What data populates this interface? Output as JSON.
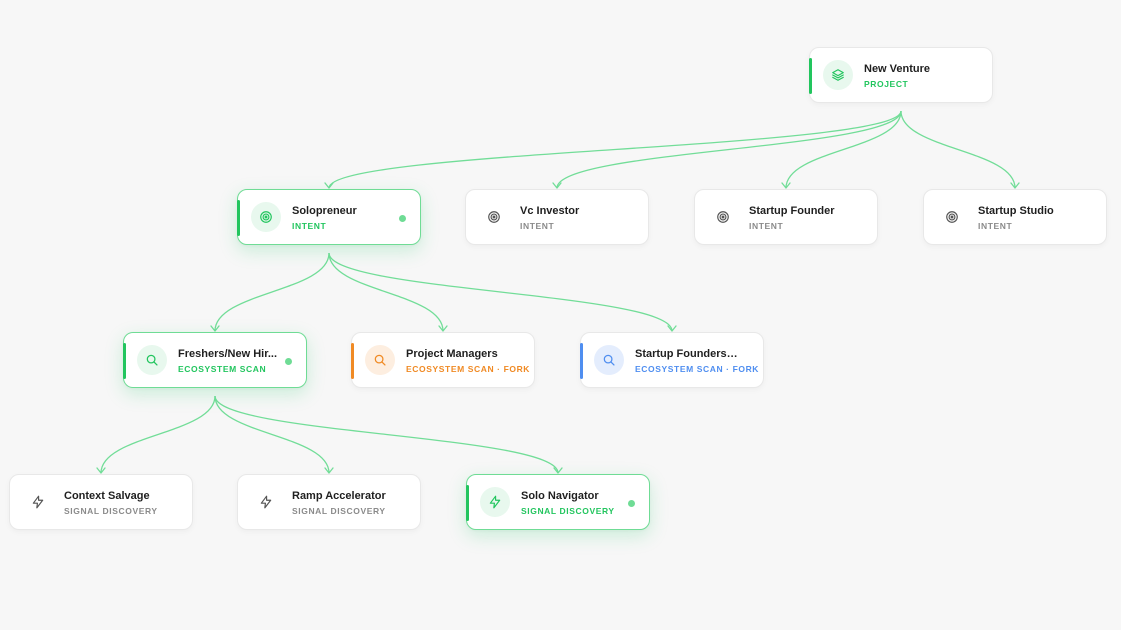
{
  "colors": {
    "green": "#22c55e",
    "green_soft": "#e8f8ee",
    "green_dot": "#6fdc95",
    "gray_text": "#8a8a8a",
    "orange": "#f08a24",
    "orange_soft": "#fdeee0",
    "blue": "#4f8ef0",
    "blue_soft": "#e4edfd",
    "edge": "#72dd98"
  },
  "nodes": [
    {
      "id": "new-venture",
      "title": "New Venture",
      "subtitle": "PROJECT",
      "icon": "layers-icon",
      "variant": "project",
      "active": false
    },
    {
      "id": "solopreneur",
      "title": "Solopreneur",
      "subtitle": "INTENT",
      "icon": "target-icon",
      "variant": "intent-active",
      "active": true
    },
    {
      "id": "vc-investor",
      "title": "Vc Investor",
      "subtitle": "INTENT",
      "icon": "target-icon",
      "variant": "intent",
      "active": false
    },
    {
      "id": "startup-founder",
      "title": "Startup Founder",
      "subtitle": "INTENT",
      "icon": "target-icon",
      "variant": "intent",
      "active": false
    },
    {
      "id": "startup-studio",
      "title": "Startup Studio",
      "subtitle": "INTENT",
      "icon": "target-icon",
      "variant": "intent",
      "active": false
    },
    {
      "id": "freshers",
      "title": "Freshers/New Hir...",
      "subtitle": "ECOSYSTEM SCAN",
      "icon": "search-icon",
      "variant": "scan-active",
      "active": true
    },
    {
      "id": "project-managers",
      "title": "Project Managers",
      "subtitle": "ECOSYSTEM SCAN · FORK",
      "icon": "search-icon",
      "variant": "fork-orange",
      "active": false
    },
    {
      "id": "startup-founders-ops",
      "title": "Startup Founders/Ops",
      "subtitle": "ECOSYSTEM SCAN · FORK",
      "icon": "search-icon",
      "variant": "fork-blue",
      "active": false
    },
    {
      "id": "context-salvage",
      "title": "Context Salvage",
      "subtitle": "SIGNAL DISCOVERY",
      "icon": "bolt-icon",
      "variant": "signal",
      "active": false
    },
    {
      "id": "ramp-accelerator",
      "title": "Ramp Accelerator",
      "subtitle": "SIGNAL DISCOVERY",
      "icon": "bolt-icon",
      "variant": "signal",
      "active": false
    },
    {
      "id": "solo-navigator",
      "title": "Solo Navigator",
      "subtitle": "SIGNAL DISCOVERY",
      "icon": "bolt-icon",
      "variant": "signal-active",
      "active": true
    }
  ],
  "edges": [
    [
      "new-venture",
      "solopreneur"
    ],
    [
      "new-venture",
      "vc-investor"
    ],
    [
      "new-venture",
      "startup-founder"
    ],
    [
      "new-venture",
      "startup-studio"
    ],
    [
      "solopreneur",
      "freshers"
    ],
    [
      "solopreneur",
      "project-managers"
    ],
    [
      "solopreneur",
      "startup-founders-ops"
    ],
    [
      "freshers",
      "context-salvage"
    ],
    [
      "freshers",
      "ramp-accelerator"
    ],
    [
      "freshers",
      "solo-navigator"
    ]
  ]
}
